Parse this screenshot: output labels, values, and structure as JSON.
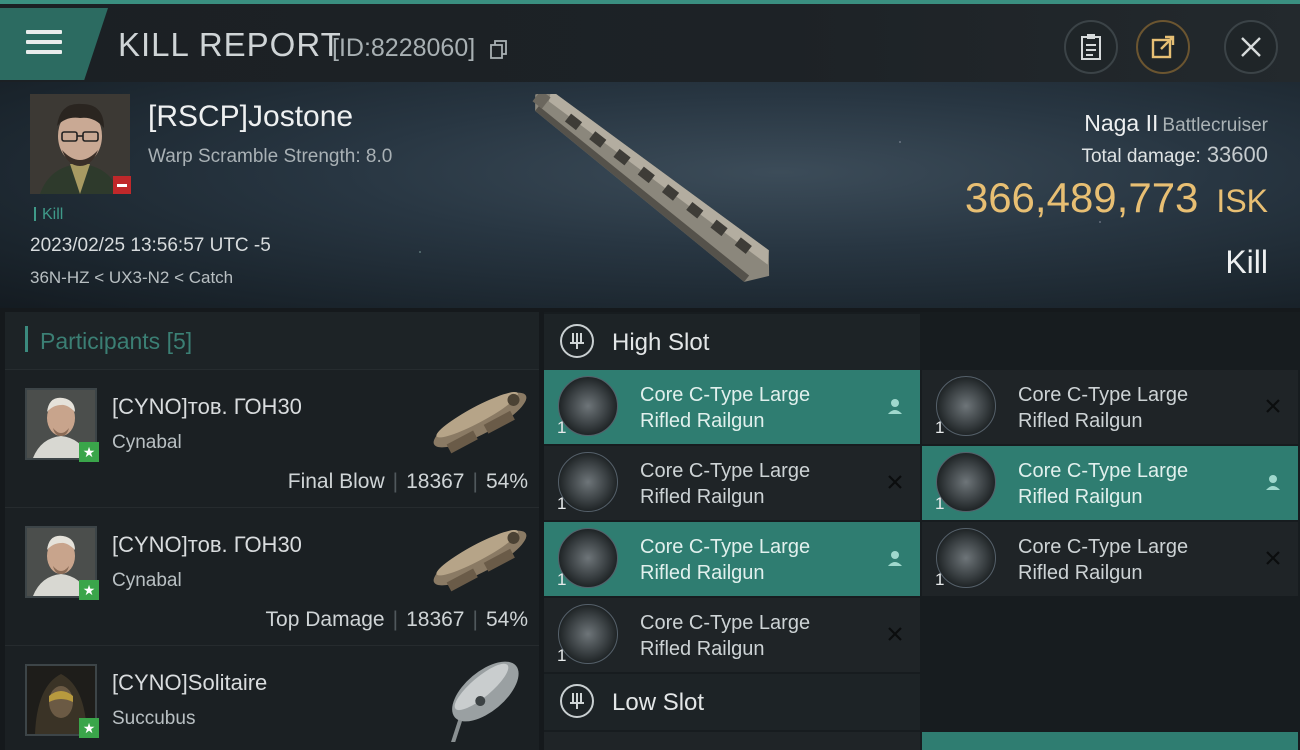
{
  "header": {
    "title": "KILL REPORT",
    "report_id": "[ID:8228060]"
  },
  "victim": {
    "name": "[RSCP]Jostone",
    "warp_scramble": "Warp Scramble Strength: 8.0",
    "kill_tag": "Kill",
    "datetime": "2023/02/25 13:56:57 UTC -5",
    "location": "36N-HZ < UX3-N2 < Catch",
    "ship_name": "Naga II",
    "ship_class": "Battlecruiser",
    "total_damage_label": "Total damage:",
    "total_damage": "33600",
    "isk_value": "366,489,773",
    "isk_unit": "ISK",
    "kill_type": "Kill"
  },
  "participants": {
    "label": "Participants",
    "count": "[5]",
    "rows": [
      {
        "name": "[CYNO]тов. ГОН30",
        "ship": "Cynabal",
        "role": "Final Blow",
        "damage": "18367",
        "percent": "54%"
      },
      {
        "name": "[CYNO]тов. ГОН30",
        "ship": "Cynabal",
        "role": "Top Damage",
        "damage": "18367",
        "percent": "54%"
      },
      {
        "name": "[CYNO]Solitaire",
        "ship": "Succubus",
        "role": "",
        "damage": "",
        "percent": ""
      }
    ]
  },
  "slots": {
    "high": {
      "label": "High Slot",
      "modules": [
        {
          "name_line1": "Core C-Type Large",
          "name_line2": "Rifled Railgun",
          "qty": "1",
          "state": "user"
        },
        {
          "name_line1": "Core C-Type Large",
          "name_line2": "Rifled Railgun",
          "qty": "1",
          "state": "destroyed"
        },
        {
          "name_line1": "Core C-Type Large",
          "name_line2": "Rifled Railgun",
          "qty": "1",
          "state": "destroyed"
        },
        {
          "name_line1": "Core C-Type Large",
          "name_line2": "Rifled Railgun",
          "qty": "1",
          "state": "user"
        },
        {
          "name_line1": "Core C-Type Large",
          "name_line2": "Rifled Railgun",
          "qty": "1",
          "state": "user"
        },
        {
          "name_line1": "Core C-Type Large",
          "name_line2": "Rifled Railgun",
          "qty": "1",
          "state": "destroyed"
        },
        {
          "name_line1": "Core C-Type Large",
          "name_line2": "Rifled Railgun",
          "qty": "1",
          "state": "destroyed"
        }
      ]
    },
    "low": {
      "label": "Low Slot"
    }
  },
  "colors": {
    "accent": "#2f7d71",
    "isk": "#e8bf73",
    "badge_green": "#3aa54a",
    "badge_red": "#c0282a"
  },
  "icons": [
    "menu-icon",
    "copy-icon",
    "clipboard-icon",
    "share-icon",
    "close-icon",
    "high-slot-icon",
    "low-slot-icon",
    "user-icon",
    "cross-icon",
    "star-icon"
  ]
}
